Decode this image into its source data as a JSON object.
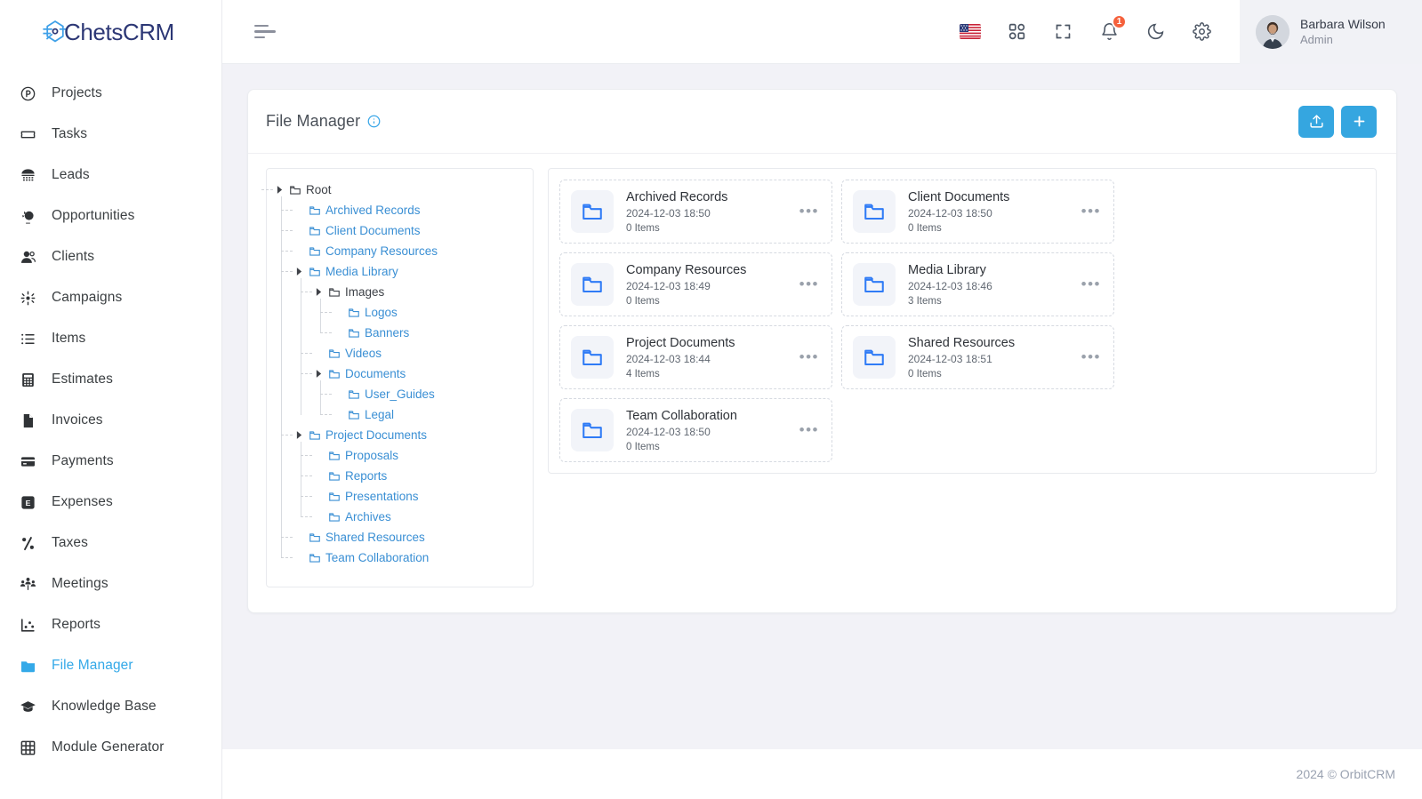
{
  "brand": {
    "name": "ChetsCRM",
    "logo_icon": "chets-logo-icon"
  },
  "sidebar": {
    "items": [
      {
        "label": "Projects",
        "icon": "circle-p-icon",
        "active": false
      },
      {
        "label": "Tasks",
        "icon": "ticket-icon",
        "active": false
      },
      {
        "label": "Leads",
        "icon": "telephone-icon",
        "active": false
      },
      {
        "label": "Opportunities",
        "icon": "lightbulb-icon",
        "active": false
      },
      {
        "label": "Clients",
        "icon": "users-icon",
        "active": false
      },
      {
        "label": "Campaigns",
        "icon": "megaphone-icon",
        "active": false
      },
      {
        "label": "Items",
        "icon": "list-icon",
        "active": false
      },
      {
        "label": "Estimates",
        "icon": "calculator-icon",
        "active": false
      },
      {
        "label": "Invoices",
        "icon": "file-icon",
        "active": false
      },
      {
        "label": "Payments",
        "icon": "credit-card-icon",
        "active": false
      },
      {
        "label": "Expenses",
        "icon": "expense-icon",
        "active": false
      },
      {
        "label": "Taxes",
        "icon": "percent-icon",
        "active": false
      },
      {
        "label": "Meetings",
        "icon": "people-group-icon",
        "active": false
      },
      {
        "label": "Reports",
        "icon": "chart-icon",
        "active": false
      },
      {
        "label": "File Manager",
        "icon": "folder-icon",
        "active": true
      },
      {
        "label": "Knowledge Base",
        "icon": "graduation-cap-icon",
        "active": false
      },
      {
        "label": "Module Generator",
        "icon": "grid-table-icon",
        "active": false
      }
    ]
  },
  "topbar": {
    "menu_toggle_icon": "hamburger-icon",
    "icons": [
      {
        "name": "language-flag-icon",
        "label": "US"
      },
      {
        "name": "apps-grid-icon",
        "label": ""
      },
      {
        "name": "fullscreen-icon",
        "label": ""
      },
      {
        "name": "notification-bell-icon",
        "label": "",
        "badge": "1"
      },
      {
        "name": "dark-mode-moon-icon",
        "label": ""
      },
      {
        "name": "settings-gear-icon",
        "label": ""
      }
    ],
    "user": {
      "name": "Barbara Wilson",
      "role": "Admin"
    }
  },
  "panel": {
    "title": "File Manager",
    "info_icon": "info-circle-icon",
    "upload_button": {
      "name": "upload-button",
      "icon": "upload-icon"
    },
    "add_button": {
      "name": "add-button",
      "icon": "plus-icon"
    }
  },
  "tree": {
    "root": {
      "label": "Root",
      "expanded": true,
      "style": "dark",
      "children": [
        {
          "label": "Archived Records",
          "expanded": false,
          "style": "link",
          "children": []
        },
        {
          "label": "Client Documents",
          "expanded": false,
          "style": "link",
          "children": []
        },
        {
          "label": "Company Resources",
          "expanded": false,
          "style": "link",
          "children": []
        },
        {
          "label": "Media Library",
          "expanded": true,
          "style": "link",
          "children": [
            {
              "label": "Images",
              "expanded": true,
              "style": "dark",
              "children": [
                {
                  "label": "Logos",
                  "expanded": false,
                  "style": "link",
                  "children": []
                },
                {
                  "label": "Banners",
                  "expanded": false,
                  "style": "link",
                  "children": []
                }
              ]
            },
            {
              "label": "Videos",
              "expanded": false,
              "style": "link",
              "children": []
            },
            {
              "label": "Documents",
              "expanded": true,
              "style": "link",
              "children": [
                {
                  "label": "User_Guides",
                  "expanded": false,
                  "style": "link",
                  "children": []
                },
                {
                  "label": "Legal",
                  "expanded": false,
                  "style": "link",
                  "children": []
                }
              ]
            }
          ]
        },
        {
          "label": "Project Documents",
          "expanded": true,
          "style": "link",
          "children": [
            {
              "label": "Proposals",
              "expanded": false,
              "style": "link",
              "children": []
            },
            {
              "label": "Reports",
              "expanded": false,
              "style": "link",
              "children": []
            },
            {
              "label": "Presentations",
              "expanded": false,
              "style": "link",
              "children": []
            },
            {
              "label": "Archives",
              "expanded": false,
              "style": "link",
              "children": []
            }
          ]
        },
        {
          "label": "Shared Resources",
          "expanded": false,
          "style": "link",
          "children": []
        },
        {
          "label": "Team Collaboration",
          "expanded": false,
          "style": "link",
          "children": []
        }
      ]
    }
  },
  "files": [
    {
      "name": "Archived Records",
      "date": "2024-12-03 18:50",
      "items": "0 Items",
      "icon": "folder-icon"
    },
    {
      "name": "Client Documents",
      "date": "2024-12-03 18:50",
      "items": "0 Items",
      "icon": "folder-icon"
    },
    {
      "name": "Company Resources",
      "date": "2024-12-03 18:49",
      "items": "0 Items",
      "icon": "folder-icon"
    },
    {
      "name": "Media Library",
      "date": "2024-12-03 18:46",
      "items": "3 Items",
      "icon": "folder-icon"
    },
    {
      "name": "Project Documents",
      "date": "2024-12-03 18:44",
      "items": "4 Items",
      "icon": "folder-icon"
    },
    {
      "name": "Shared Resources",
      "date": "2024-12-03 18:51",
      "items": "0 Items",
      "icon": "folder-icon"
    },
    {
      "name": "Team Collaboration",
      "date": "2024-12-03 18:50",
      "items": "0 Items",
      "icon": "folder-icon"
    }
  ],
  "footer": {
    "text": "2024 © OrbitCRM"
  },
  "colors": {
    "accent": "#35a6e0",
    "brand": "#2c3775",
    "badge": "#f5613c",
    "tree_link": "#3a8fd4"
  }
}
